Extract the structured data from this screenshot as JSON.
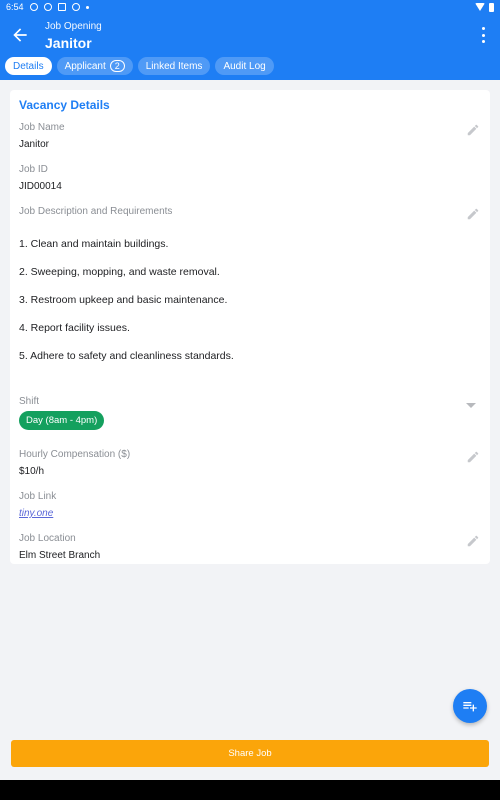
{
  "status_bar": {
    "time": "6:54"
  },
  "app_bar": {
    "subtitle": "Job Opening",
    "title": "Janitor"
  },
  "tabs": [
    {
      "label": "Details",
      "active": true
    },
    {
      "label": "Applicant",
      "badge": "2"
    },
    {
      "label": "Linked Items"
    },
    {
      "label": "Audit Log"
    }
  ],
  "vacancy": {
    "section_title": "Vacancy Details",
    "job_name": {
      "label": "Job Name",
      "value": "Janitor"
    },
    "job_id": {
      "label": "Job ID",
      "value": "JID00014"
    },
    "description": {
      "label": "Job Description and Requirements",
      "lines": [
        "1. Clean and maintain buildings.",
        "2. Sweeping, mopping, and waste removal.",
        "3. Restroom upkeep and basic maintenance.",
        "4. Report facility issues.",
        "5. Adhere to safety and cleanliness standards."
      ]
    },
    "shift": {
      "label": "Shift",
      "value": "Day (8am - 4pm)"
    },
    "compensation": {
      "label": "Hourly Compensation ($)",
      "value": "$10/h"
    },
    "job_link": {
      "label": "Job Link",
      "value": "tiny.one"
    },
    "location": {
      "label": "Job Location",
      "value": "Elm Street Branch"
    }
  },
  "share_button": {
    "label": "Share Job"
  },
  "colors": {
    "primary": "#1e7ef4",
    "accent": "#fba50a",
    "chip": "#14a05e"
  }
}
